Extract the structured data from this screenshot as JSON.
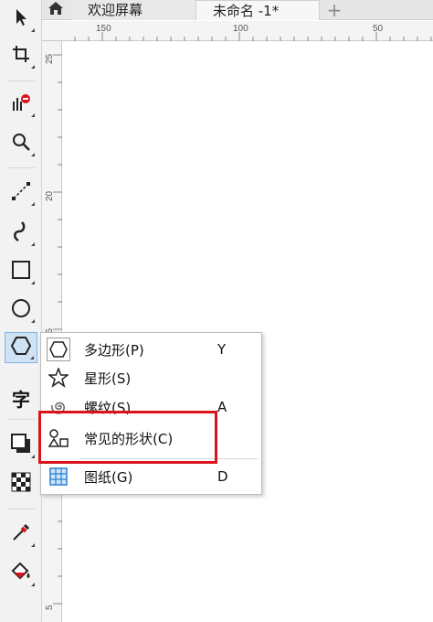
{
  "tabs": [
    {
      "label": "欢迎屏幕"
    },
    {
      "label": "未命名 -1*"
    }
  ],
  "add_tab_symbol": "+",
  "ruler_top": [
    "150",
    "100",
    "50"
  ],
  "ruler_left": [
    "25",
    "20",
    "15",
    "5"
  ],
  "toolbox": [
    {
      "icon": "pick-tool-icon"
    },
    {
      "icon": "crop-tool-icon"
    },
    {
      "icon": "shape-tool-icon"
    },
    {
      "icon": "zoom-tool-icon"
    },
    {
      "icon": "freehand-tool-icon"
    },
    {
      "icon": "artistic-media-icon"
    },
    {
      "icon": "rectangle-tool-icon"
    },
    {
      "icon": "ellipse-tool-icon"
    },
    {
      "icon": "polygon-tool-icon"
    },
    {
      "label": "字",
      "icon": "text-tool-icon"
    },
    {
      "icon": "drop-shadow-tool-icon"
    },
    {
      "icon": "transparency-tool-icon"
    },
    {
      "icon": "eyedropper-tool-icon"
    },
    {
      "icon": "fill-tool-icon"
    }
  ],
  "flyout": {
    "items": [
      {
        "label": "多边形(P)",
        "key": "Y",
        "icon": "polygon-icon"
      },
      {
        "label": "星形(S)",
        "key": "",
        "icon": "star-icon"
      },
      {
        "label": "螺纹(S)",
        "key": "A",
        "icon": "spiral-icon"
      },
      {
        "label": "常见的形状(C)",
        "key": "",
        "icon": "common-shapes-icon"
      },
      {
        "label": "图纸(G)",
        "key": "D",
        "icon": "graph-paper-icon"
      }
    ]
  },
  "colors": {
    "highlight": "#d9141b",
    "active_tool": "#cfe3f5"
  }
}
